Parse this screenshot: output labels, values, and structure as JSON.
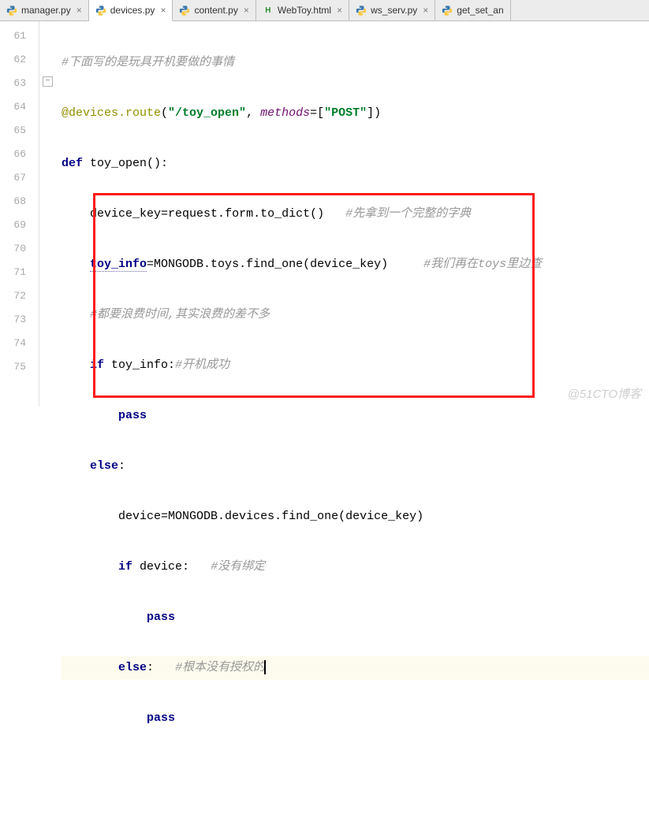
{
  "tabs": [
    {
      "label": "manager.py",
      "icon": "python-icon",
      "active": false
    },
    {
      "label": "devices.py",
      "icon": "python-icon",
      "active": true
    },
    {
      "label": "content.py",
      "icon": "python-icon",
      "active": false
    },
    {
      "label": "WebToy.html",
      "icon": "html-icon",
      "active": false
    },
    {
      "label": "ws_serv.py",
      "icon": "python-icon",
      "active": false
    },
    {
      "label": "get_set_an",
      "icon": "python-icon",
      "active": false,
      "truncated": true
    }
  ],
  "line_numbers": [
    "61",
    "62",
    "63",
    "64",
    "65",
    "66",
    "67",
    "68",
    "69",
    "70",
    "71",
    "72",
    "73",
    "74",
    "75"
  ],
  "code": {
    "l61": {
      "comment": "#下面写的是玩具开机要做的事情"
    },
    "l62": {
      "dec": "@devices.route",
      "lparen": "(",
      "str1": "\"/toy_open\"",
      "comma": ", ",
      "arg": "methods",
      "eq": "=",
      "lb": "[",
      "str2": "\"POST\"",
      "rb": "]",
      "rparen": ")"
    },
    "l63": {
      "kw": "def ",
      "fn": "toy_open",
      "p": "():"
    },
    "l64": {
      "var": "device_key",
      "eq": "=",
      "call1": "request.",
      "call2": "form.",
      "call3": "to_dict",
      "p": "()",
      "cmt": "#先拿到一个完整的字典"
    },
    "l65": {
      "link": "toy_info",
      "eq": "=",
      "call": "MONGODB.toys.find_one(device_key)",
      "cmt": "#我们再在toys里边查"
    },
    "l66": {
      "cmt": "#都要浪费时间,其实浪费的差不多"
    },
    "l67": {
      "kw": "if ",
      "var": "toy_info:",
      "cmt": "#开机成功"
    },
    "l68": {
      "kw": "pass"
    },
    "l69": {
      "kw": "else",
      "colon": ":"
    },
    "l70": {
      "var": "device",
      "eq": "=",
      "call": "MONGODB.devices.find_one(device_key)"
    },
    "l71": {
      "kw": "if ",
      "var": "device:",
      "cmt": "#没有绑定"
    },
    "l72": {
      "kw": "pass"
    },
    "l73": {
      "kw": "else",
      "colon": ":",
      "cmt": "#根本没有授权的"
    },
    "l74": {
      "kw": "pass"
    }
  },
  "watermark": "@51CTO博客"
}
